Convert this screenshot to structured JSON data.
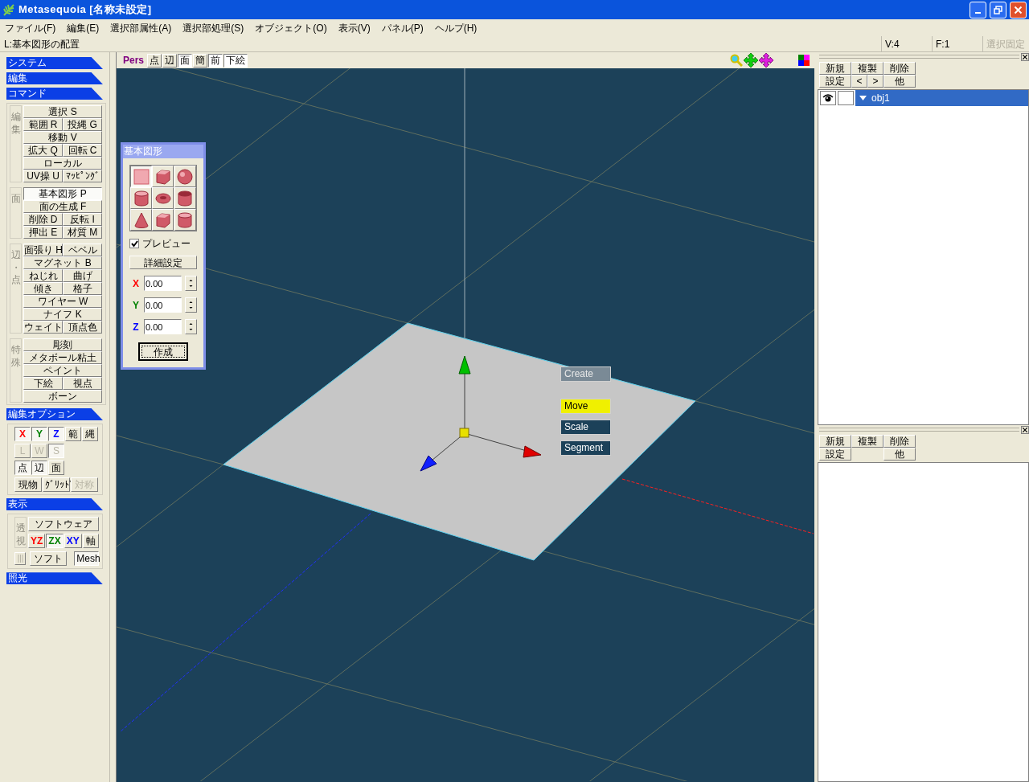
{
  "window": {
    "title": "Metasequoia [名称未設定]"
  },
  "menu": [
    "ファイル(F)",
    "編集(E)",
    "選択部属性(A)",
    "選択部処理(S)",
    "オブジェクト(O)",
    "表示(V)",
    "パネル(P)",
    "ヘルプ(H)"
  ],
  "status_bar": {
    "hint": "L:基本図形の配置",
    "vertex_count": "V:4",
    "face_count": "F:1",
    "lock_button": {
      "label": "選択固定",
      "disabled": true
    }
  },
  "left_panel": {
    "sections": [
      {
        "kind": "collapsed",
        "title": "システム"
      },
      {
        "kind": "collapsed",
        "title": "編集"
      },
      {
        "kind": "commands",
        "title": "コマンド",
        "groups": [
          {
            "label": "編集",
            "rows": [
              [
                {
                  "label": "選択 S",
                  "selected": false
                }
              ],
              [
                {
                  "label": "範囲 R",
                  "selected": false
                },
                {
                  "label": "投縄 G",
                  "selected": false
                }
              ],
              [
                {
                  "label": "移動 V",
                  "selected": false
                }
              ],
              [
                {
                  "label": "拡大 Q",
                  "selected": false
                },
                {
                  "label": "回転 C",
                  "selected": false
                }
              ],
              [
                {
                  "label": "ローカル",
                  "selected": false
                }
              ],
              [
                {
                  "label": "UV操 U",
                  "selected": false
                },
                {
                  "label": "ﾏｯﾋﾟﾝｸﾞ",
                  "selected": false
                }
              ]
            ]
          },
          {
            "label": "面",
            "rows": [
              [
                {
                  "label": "基本図形 P",
                  "selected": true
                }
              ],
              [
                {
                  "label": "面の生成 F",
                  "selected": false
                }
              ],
              [
                {
                  "label": "削除 D",
                  "selected": false
                },
                {
                  "label": "反転 I",
                  "selected": false
                }
              ],
              [
                {
                  "label": "押出 E",
                  "selected": false
                },
                {
                  "label": "材質 M",
                  "selected": false
                }
              ]
            ]
          },
          {
            "label": "辺・点",
            "rows": [
              [
                {
                  "label": "面張り H",
                  "selected": false
                },
                {
                  "label": "ベベル",
                  "selected": false
                }
              ],
              [
                {
                  "label": "マグネット B",
                  "selected": false
                }
              ],
              [
                {
                  "label": "ねじれ",
                  "selected": false
                },
                {
                  "label": "曲げ",
                  "selected": false
                }
              ],
              [
                {
                  "label": "傾き",
                  "selected": false
                },
                {
                  "label": "格子",
                  "selected": false
                }
              ],
              [
                {
                  "label": "ワイヤー W",
                  "selected": false
                }
              ],
              [
                {
                  "label": "ナイフ K",
                  "selected": false
                }
              ],
              [
                {
                  "label": "ウェイト",
                  "selected": false
                },
                {
                  "label": "頂点色",
                  "selected": false
                }
              ]
            ]
          },
          {
            "label": "特殊",
            "rows": [
              [
                {
                  "label": "彫刻",
                  "selected": false
                }
              ],
              [
                {
                  "label": "メタボール粘土",
                  "selected": false
                }
              ],
              [
                {
                  "label": "ペイント",
                  "selected": false
                }
              ],
              [
                {
                  "label": "下絵",
                  "selected": false
                },
                {
                  "label": "視点",
                  "selected": false
                }
              ],
              [
                {
                  "label": "ボーン",
                  "selected": false
                }
              ]
            ]
          }
        ]
      },
      {
        "kind": "options",
        "title": "編集オプション",
        "rows": [
          [
            {
              "label": "X",
              "color": "#ff0000",
              "pressed": true,
              "disabled": false
            },
            {
              "label": "Y",
              "color": "#008000",
              "pressed": true,
              "disabled": false
            },
            {
              "label": "Z",
              "color": "#0000ff",
              "pressed": true,
              "disabled": false
            },
            {
              "label": "範",
              "pressed": false,
              "disabled": false
            },
            {
              "label": "縄",
              "pressed": false,
              "disabled": false
            }
          ],
          [
            {
              "label": "L",
              "pressed": false,
              "disabled": true
            },
            {
              "label": "W",
              "pressed": false,
              "disabled": true
            },
            {
              "label": "S",
              "pressed": true,
              "disabled": true
            }
          ],
          [
            {
              "label": "点",
              "pressed": true,
              "disabled": false
            },
            {
              "label": "辺",
              "pressed": true,
              "disabled": false
            },
            {
              "label": "面",
              "pressed": false,
              "disabled": false
            }
          ]
        ],
        "wide_buttons": [
          {
            "label": "現物",
            "pressed": false,
            "disabled": false
          },
          {
            "label": "ｸﾞﾘｯﾄﾞ",
            "pressed": false,
            "disabled": false
          },
          {
            "label": "対称",
            "pressed": false,
            "disabled": true
          }
        ]
      },
      {
        "kind": "display",
        "title": "表示",
        "group": {
          "label": "透視",
          "rows": [
            [
              {
                "label": "ソフトウェア",
                "pressed": false,
                "disabled": false
              }
            ],
            [
              {
                "label": "YZ",
                "color": "#ff0000",
                "pressed": false,
                "disabled": false
              },
              {
                "label": "ZX",
                "color": "#008000",
                "pressed": true,
                "disabled": false
              },
              {
                "label": "XY",
                "color": "#0000ff",
                "pressed": false,
                "disabled": false
              },
              {
                "label": "軸",
                "pressed": false,
                "disabled": false
              }
            ]
          ]
        },
        "rows": [
          [
            {
              "kind": "icon",
              "pressed": false,
              "disabled": true
            },
            {
              "kind": "text",
              "label": "ソフト",
              "pressed": false,
              "disabled": false
            },
            {
              "kind": "text",
              "label": "Mesh",
              "pressed": true,
              "disabled": false
            }
          ]
        ]
      },
      {
        "kind": "collapsed",
        "title": "照光"
      }
    ]
  },
  "viewport": {
    "mode": "Pers",
    "buttons": [
      {
        "label": "点",
        "pressed": false
      },
      {
        "label": "辺",
        "pressed": false
      },
      {
        "label": "面",
        "pressed": true
      },
      {
        "label": "簡",
        "pressed": false
      },
      {
        "label": "前",
        "pressed": true
      },
      {
        "label": "下絵",
        "pressed": true
      }
    ],
    "primitive_dialog": {
      "title": "基本図形",
      "shapes": [
        {
          "kind": "plane",
          "selected": true
        },
        {
          "kind": "cube",
          "selected": false
        },
        {
          "kind": "sphere",
          "selected": false
        },
        {
          "kind": "cylinder",
          "selected": false
        },
        {
          "kind": "torus",
          "selected": false
        },
        {
          "kind": "pipe",
          "selected": false
        },
        {
          "kind": "cone",
          "selected": false
        },
        {
          "kind": "rounded-cube",
          "selected": false
        },
        {
          "kind": "rounded-cylinder",
          "selected": false
        }
      ],
      "preview": {
        "label": "プレビュー",
        "checked": true
      },
      "details_button": "詳細設定",
      "fields": [
        {
          "axis": "X",
          "value": "0.00",
          "color": "#ff0000"
        },
        {
          "axis": "Y",
          "value": "0.00",
          "color": "#008000"
        },
        {
          "axis": "Z",
          "value": "0.00",
          "color": "#0000ff"
        }
      ],
      "create_button": "作成"
    },
    "handle_menu": [
      {
        "kind": "label",
        "label": "Create",
        "selected": false
      },
      {
        "kind": "button",
        "label": "Move",
        "selected": true
      },
      {
        "kind": "button",
        "label": "Scale",
        "selected": false
      },
      {
        "kind": "button",
        "label": "Segment",
        "selected": false
      }
    ]
  },
  "object_panel": {
    "buttons": [
      [
        "新規",
        "複製",
        "削除"
      ],
      [
        "設定",
        "<",
        ">",
        "他"
      ]
    ],
    "objects": [
      {
        "name": "obj1",
        "visible": true,
        "locked": false,
        "expanded": true,
        "selected": true
      }
    ]
  },
  "material_panel": {
    "buttons": [
      [
        "新規",
        "複製",
        "削除"
      ],
      [
        "設定",
        "他"
      ]
    ]
  }
}
